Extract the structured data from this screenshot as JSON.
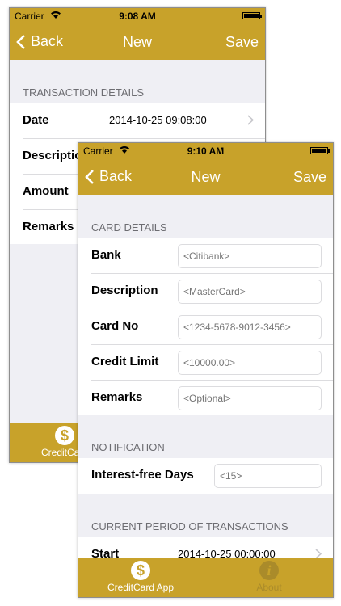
{
  "back_screen": {
    "status": {
      "carrier": "Carrier",
      "time": "9:08 AM"
    },
    "nav": {
      "back": "Back",
      "title": "New",
      "save": "Save"
    },
    "section": "TRANSACTION DETAILS",
    "rows": [
      {
        "label": "Date",
        "value": "2014-10-25 09:08:00"
      },
      {
        "label": "Descriptio"
      },
      {
        "label": "Amount"
      },
      {
        "label": "Remarks"
      }
    ],
    "tab_label": "CreditCard"
  },
  "front_screen": {
    "status": {
      "carrier": "Carrier",
      "time": "9:10 AM"
    },
    "nav": {
      "back": "Back",
      "title": "New",
      "save": "Save"
    },
    "card_details": {
      "header": "CARD DETAILS",
      "rows": [
        {
          "label": "Bank",
          "placeholder": "<Citibank>"
        },
        {
          "label": "Description",
          "placeholder": "<MasterCard>"
        },
        {
          "label": "Card No",
          "placeholder": "<1234-5678-9012-3456>"
        },
        {
          "label": "Credit Limit",
          "placeholder": "<10000.00>"
        },
        {
          "label": "Remarks",
          "placeholder": "<Optional>"
        }
      ]
    },
    "notification": {
      "header": "NOTIFICATION",
      "rows": [
        {
          "label": "Interest-free Days",
          "placeholder": "<15>"
        }
      ]
    },
    "current_period": {
      "header": "CURRENT PERIOD OF TRANSACTIONS",
      "rows": [
        {
          "label": "Start",
          "value": "2014-10-25 00:00:00"
        }
      ]
    },
    "tabs": [
      {
        "label": "CreditCard App",
        "icon": "dollar-icon",
        "glyph": "$"
      },
      {
        "label": "About",
        "icon": "info-icon",
        "glyph": "i"
      }
    ]
  },
  "colors": {
    "accent": "#c8a22a",
    "background": "#efeff4",
    "placeholder": "#c7c7cd",
    "section_text": "#6d6d72"
  }
}
